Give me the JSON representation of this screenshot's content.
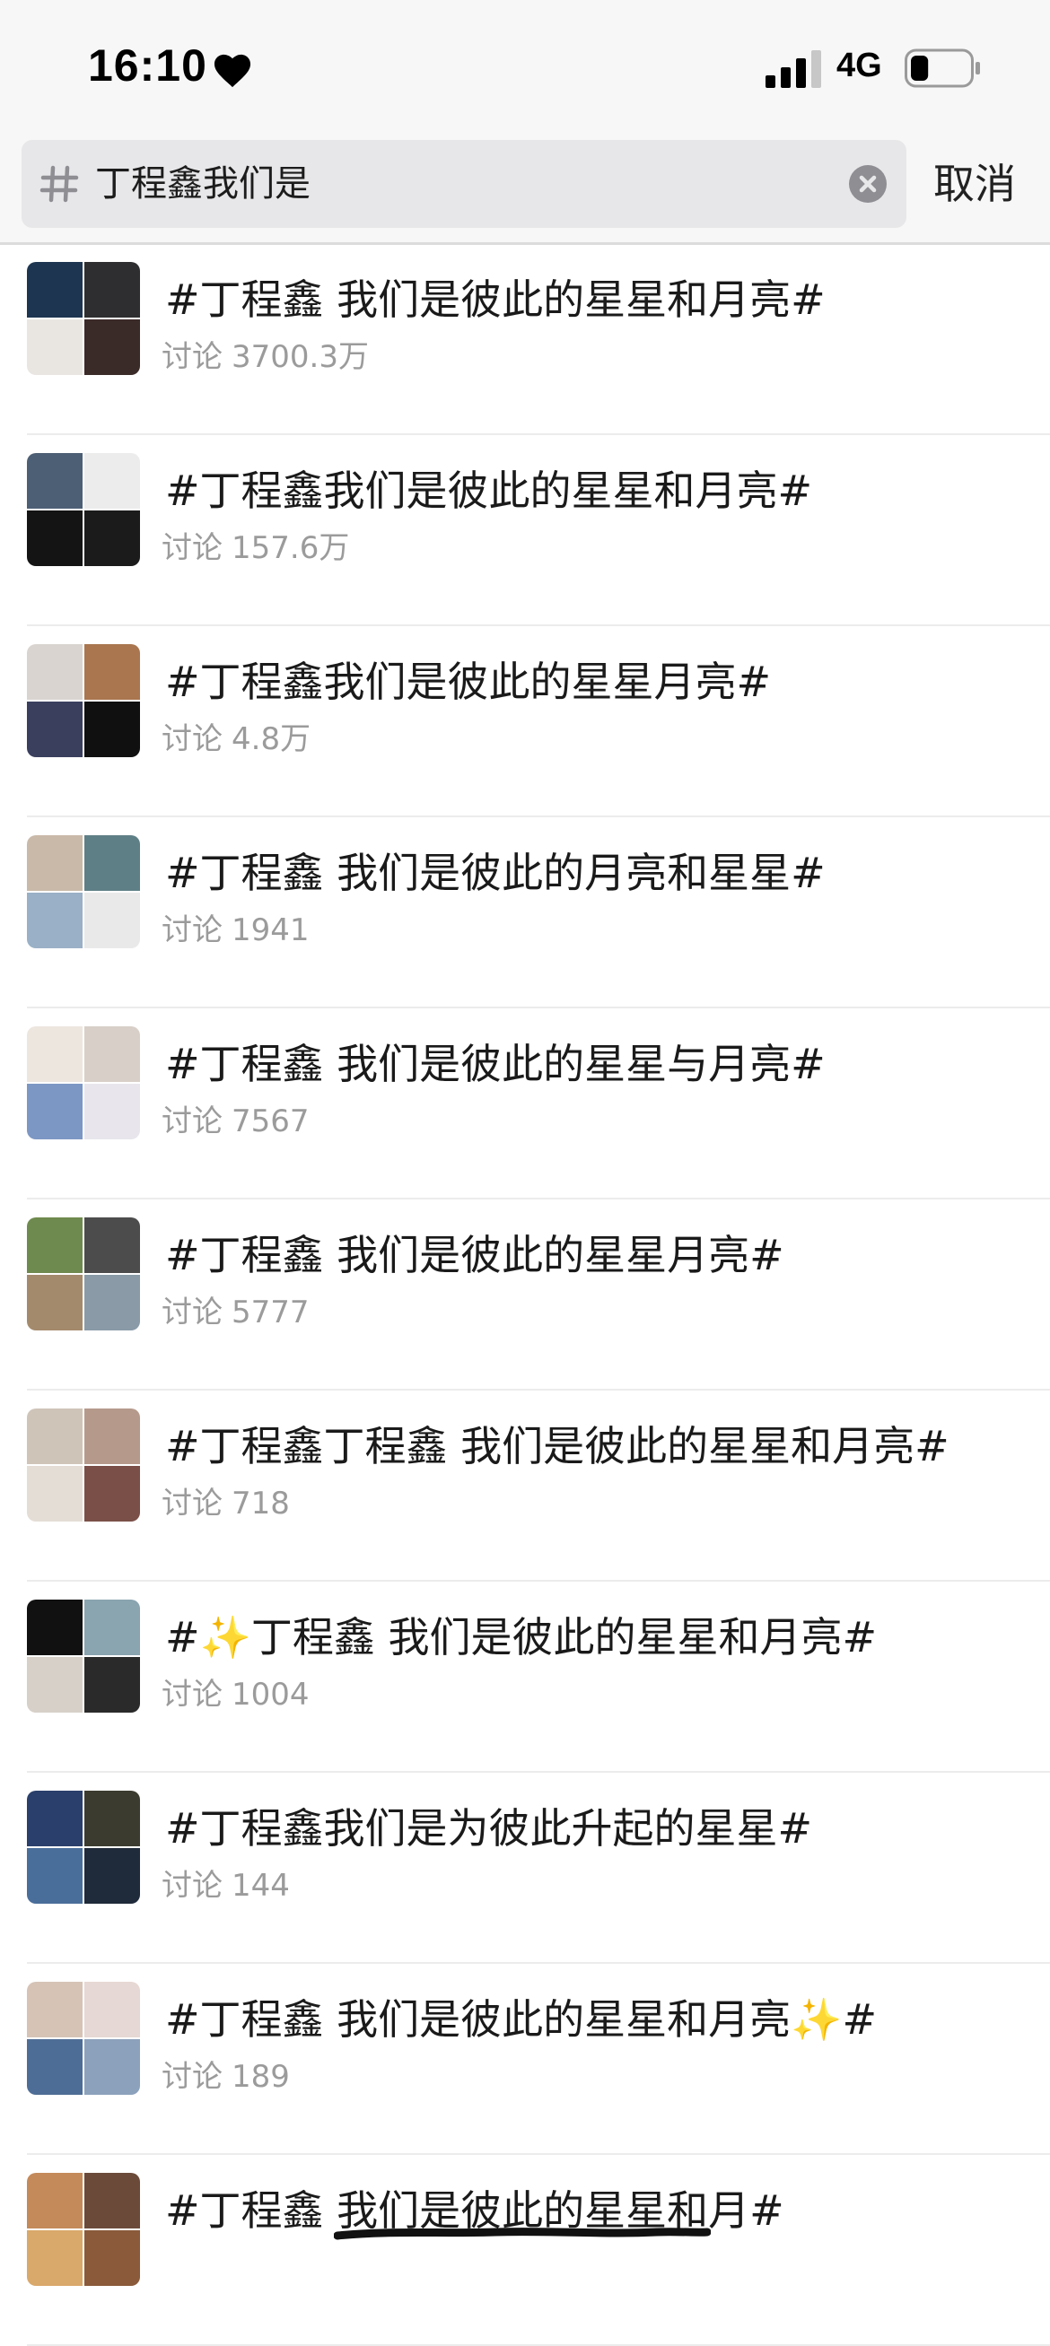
{
  "status_bar": {
    "time": "16:10",
    "network": "4G",
    "battery_level": 0.3
  },
  "search": {
    "value": "丁程鑫我们是",
    "cancel_label": "取消"
  },
  "topics": [
    {
      "title": "#丁程鑫 我们是彼此的星星和月亮#",
      "discuss_label": "讨论",
      "count": "3700.3万",
      "thumb_colors": [
        "#1d3550",
        "#2e2e30",
        "#e9e6e2",
        "#3a2a28"
      ]
    },
    {
      "title": "#丁程鑫我们是彼此的星星和月亮#",
      "discuss_label": "讨论",
      "count": "157.6万",
      "thumb_colors": [
        "#4d5f75",
        "#ececec",
        "#141414",
        "#1b1b1b"
      ]
    },
    {
      "title": "#丁程鑫我们是彼此的星星月亮#",
      "discuss_label": "讨论",
      "count": "4.8万",
      "thumb_colors": [
        "#d9d4d0",
        "#a9764f",
        "#3a3f5e",
        "#101010"
      ]
    },
    {
      "title": "#丁程鑫 我们是彼此的月亮和星星#",
      "discuss_label": "讨论",
      "count": "1941",
      "thumb_colors": [
        "#c9b9a8",
        "#5f7f86",
        "#9ab0c6",
        "#e9e9e9"
      ]
    },
    {
      "title": "#丁程鑫 我们是彼此的星星与月亮#",
      "discuss_label": "讨论",
      "count": "7567",
      "thumb_colors": [
        "#ece6df",
        "#d8cfc8",
        "#7d97c4",
        "#e8e6ec"
      ]
    },
    {
      "title": "#丁程鑫 我们是彼此的星星月亮#",
      "discuss_label": "讨论",
      "count": "5777",
      "thumb_colors": [
        "#6f8a4e",
        "#4c4c4c",
        "#a48a6c",
        "#8a9aa7"
      ]
    },
    {
      "title": "#丁程鑫丁程鑫 我们是彼此的星星和月亮#",
      "discuss_label": "讨论",
      "count": "718",
      "thumb_colors": [
        "#cfc4b8",
        "#b59a8c",
        "#e4ddd5",
        "#7a4f48"
      ]
    },
    {
      "title": "#✨丁程鑫 我们是彼此的星星和月亮#",
      "discuss_label": "讨论",
      "count": "1004",
      "thumb_colors": [
        "#111111",
        "#8aa4b0",
        "#d7d0c9",
        "#2a2a2a"
      ]
    },
    {
      "title": "#丁程鑫我们是为彼此升起的星星#",
      "discuss_label": "讨论",
      "count": "144",
      "thumb_colors": [
        "#2a3f6b",
        "#3b3b2f",
        "#4a6e9a",
        "#1f2a3a"
      ]
    },
    {
      "title": "#丁程鑫 我们是彼此的星星和月亮✨#",
      "discuss_label": "讨论",
      "count": "189",
      "thumb_colors": [
        "#d6c3b6",
        "#e6d8d4",
        "#4e6d96",
        "#8ca1bb"
      ]
    },
    {
      "title": "#丁程鑫 我们是彼此的星星和月#",
      "discuss_label": "讨论",
      "count": "",
      "thumb_colors": [
        "#c48a5a",
        "#6b4a3a",
        "#d9a86b",
        "#8a5a3a"
      ]
    }
  ]
}
